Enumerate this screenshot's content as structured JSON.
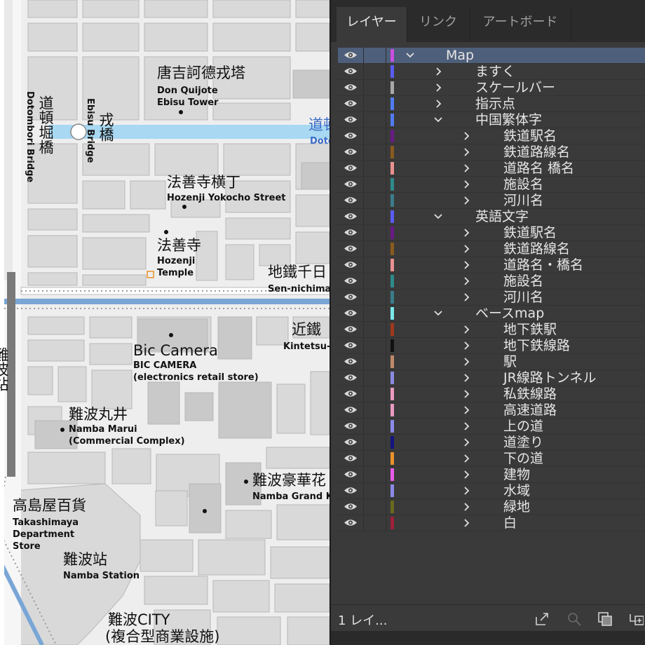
{
  "map": {
    "labels": {
      "donquijote_ja": "唐吉訶德戎塔",
      "donquijote_en": "Don Quijote\nEbisu Tower",
      "dotonbori_ja": "道頓堀橋",
      "dotonbori_en": "Dotombori Bridge",
      "ebisu_ja": "戎橋",
      "ebisu_en": "Ebisu Bridge",
      "dotonbori_river_ja": "道頓",
      "dotonbori_river_en": "Doto",
      "hozenji_yokocho_ja": "法善寺横丁",
      "hozenji_yokocho_en": "Hozenji Yokocho Street",
      "hozenji_ja": "法善寺",
      "hozenji_en": "Hozenji\nTemple",
      "sennichimae_ja": "地鐵千日",
      "sennichimae_en": "Sen-nichima",
      "kintetsu_ja": "近鐵",
      "kintetsu_en": "Kintetsu-",
      "biccamera_ja": "Bic Camera",
      "biccamera_en": "BIC CAMERA\n(electronics retail store)",
      "marui_ja": "難波丸井",
      "marui_en": "Namba Marui\n(Commercial Complex)",
      "grand_ja": "難波豪華花",
      "grand_en": "Namba Grand K",
      "takashimaya_ja": "高島屋百貨",
      "takashimaya_en": "Takashimaya\nDepartment\nStore",
      "namba_station_ja": "難波站",
      "namba_station_en": "Namba Station",
      "nambacity_ja": "難波CITY",
      "nambacity_sub": "(複合型商業設施)",
      "left_edge_ja": "難波站"
    }
  },
  "panel": {
    "tabs": [
      "レイヤー",
      "リンク",
      "アートボード"
    ],
    "active_tab": 0,
    "layers": [
      {
        "name": "Map",
        "color": "#c94ee0",
        "level": 0,
        "expanded": true,
        "selected": true
      },
      {
        "name": "ますく",
        "color": "#5a5cf0",
        "level": 1,
        "expanded": false
      },
      {
        "name": "スケールバー",
        "color": "#a8a8a8",
        "level": 1,
        "expanded": false
      },
      {
        "name": "指示点",
        "color": "#4f7cf0",
        "level": 1,
        "expanded": false
      },
      {
        "name": "中国繁体字",
        "color": "#4f7cf0",
        "level": 1,
        "expanded": true
      },
      {
        "name": "鉄道駅名",
        "color": "#6a1a86",
        "level": 2,
        "expanded": false
      },
      {
        "name": "鉄道路線名",
        "color": "#8a5a1e",
        "level": 2,
        "expanded": false
      },
      {
        "name": "道路名 橋名",
        "color": "#e89090",
        "level": 2,
        "expanded": false
      },
      {
        "name": "施設名",
        "color": "#2f8a8a",
        "level": 2,
        "expanded": false
      },
      {
        "name": "河川名",
        "color": "#3a7d8a",
        "level": 2,
        "expanded": false
      },
      {
        "name": "英語文字",
        "color": "#5a5cf0",
        "level": 1,
        "expanded": true
      },
      {
        "name": "鉄道駅名",
        "color": "#6a1a86",
        "level": 2,
        "expanded": false
      },
      {
        "name": "鉄道路線名",
        "color": "#8a5a1e",
        "level": 2,
        "expanded": false
      },
      {
        "name": "道路名・橋名",
        "color": "#e89090",
        "level": 2,
        "expanded": false
      },
      {
        "name": "施設名",
        "color": "#2f8a8a",
        "level": 2,
        "expanded": false
      },
      {
        "name": "河川名",
        "color": "#3a7d8a",
        "level": 2,
        "expanded": false
      },
      {
        "name": "ベースmap",
        "color": "#7ae8e8",
        "level": 1,
        "expanded": true
      },
      {
        "name": "地下鉄駅",
        "color": "#a0381e",
        "level": 2,
        "expanded": false
      },
      {
        "name": "地下鉄線路",
        "color": "#111111",
        "level": 2,
        "expanded": false
      },
      {
        "name": "駅",
        "color": "#c08a6a",
        "level": 2,
        "expanded": false
      },
      {
        "name": "JR線路トンネル",
        "color": "#8a8ae0",
        "level": 2,
        "expanded": false
      },
      {
        "name": "私鉄線路",
        "color": "#e89ac0",
        "level": 2,
        "expanded": false
      },
      {
        "name": "高速道路",
        "color": "#e89ac0",
        "level": 2,
        "expanded": false
      },
      {
        "name": "上の道",
        "color": "#8a8ae8",
        "level": 2,
        "expanded": false
      },
      {
        "name": "道塗り",
        "color": "#141480",
        "level": 2,
        "expanded": false
      },
      {
        "name": "下の道",
        "color": "#e8922a",
        "level": 2,
        "expanded": false
      },
      {
        "name": "建物",
        "color": "#e85ae8",
        "level": 2,
        "expanded": false
      },
      {
        "name": "水域",
        "color": "#8a8ae8",
        "level": 2,
        "expanded": false
      },
      {
        "name": "緑地",
        "color": "#6a6a1e",
        "level": 2,
        "expanded": false
      },
      {
        "name": "白",
        "color": "#a0203a",
        "level": 2,
        "expanded": false
      }
    ],
    "footer": {
      "count_label": "1 レイ..."
    }
  }
}
